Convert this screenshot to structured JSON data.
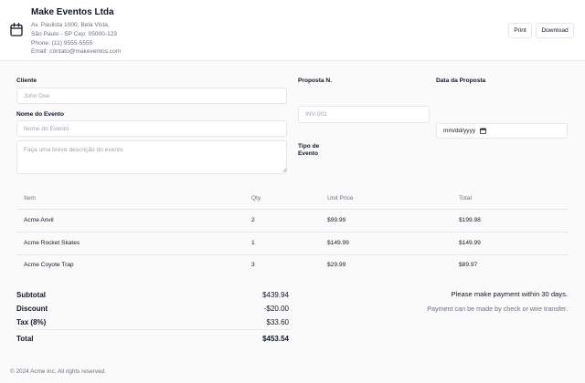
{
  "company": {
    "name": "Make Eventos Ltda",
    "address_lines": [
      "Av. Paulista 1000, Bela Vista,",
      "São Paulo - SP Cep: 05000-123",
      "Phone: (11) 9555-5555",
      "Email: contato@makeventos.com"
    ],
    "icon": "calendar-icon"
  },
  "toolbar": {
    "print_label": "Print",
    "download_label": "Download"
  },
  "form": {
    "cliente_label": "Cliente",
    "cliente_placeholder": "John Doe",
    "nome_evento_label": "Nome do Evento",
    "nome_evento_placeholder": "Nome do Evento",
    "descricao_placeholder": "Faça uma breve descrição do evento",
    "proposta_label": "Proposta N.",
    "proposta_placeholder": "INV-001",
    "tipo_evento_label_line1": "Tipo de",
    "tipo_evento_label_line2": "Evento",
    "data_label": "Data da Proposta",
    "data_placeholder": "mm/dd/yyyy",
    "date_icon": "calendar-small-icon"
  },
  "table": {
    "headers": {
      "item": "Item",
      "qty": "Qty",
      "unit_price": "Unit Price",
      "total": "Total"
    },
    "rows": [
      {
        "item": "Acme Anvil",
        "qty": "2",
        "unit_price": "$99.99",
        "total": "$199.98"
      },
      {
        "item": "Acme Rocket Skates",
        "qty": "1",
        "unit_price": "$149.99",
        "total": "$149.99"
      },
      {
        "item": "Acme Coyote Trap",
        "qty": "3",
        "unit_price": "$29.99",
        "total": "$89.97"
      }
    ]
  },
  "summary": {
    "subtotal_label": "Subtotal",
    "subtotal_value": "$439.94",
    "discount_label": "Discount",
    "discount_value": "-$20.00",
    "tax_label": "Tax (8%)",
    "tax_value": "$33.60",
    "total_label": "Total",
    "total_value": "$453.54"
  },
  "notes": {
    "main": "Please make payment within 30 days.",
    "sub": "Payment can be made by check or wire transfer."
  },
  "footer": {
    "copyright": "© 2024 Acme Inc. All rights reserved."
  }
}
